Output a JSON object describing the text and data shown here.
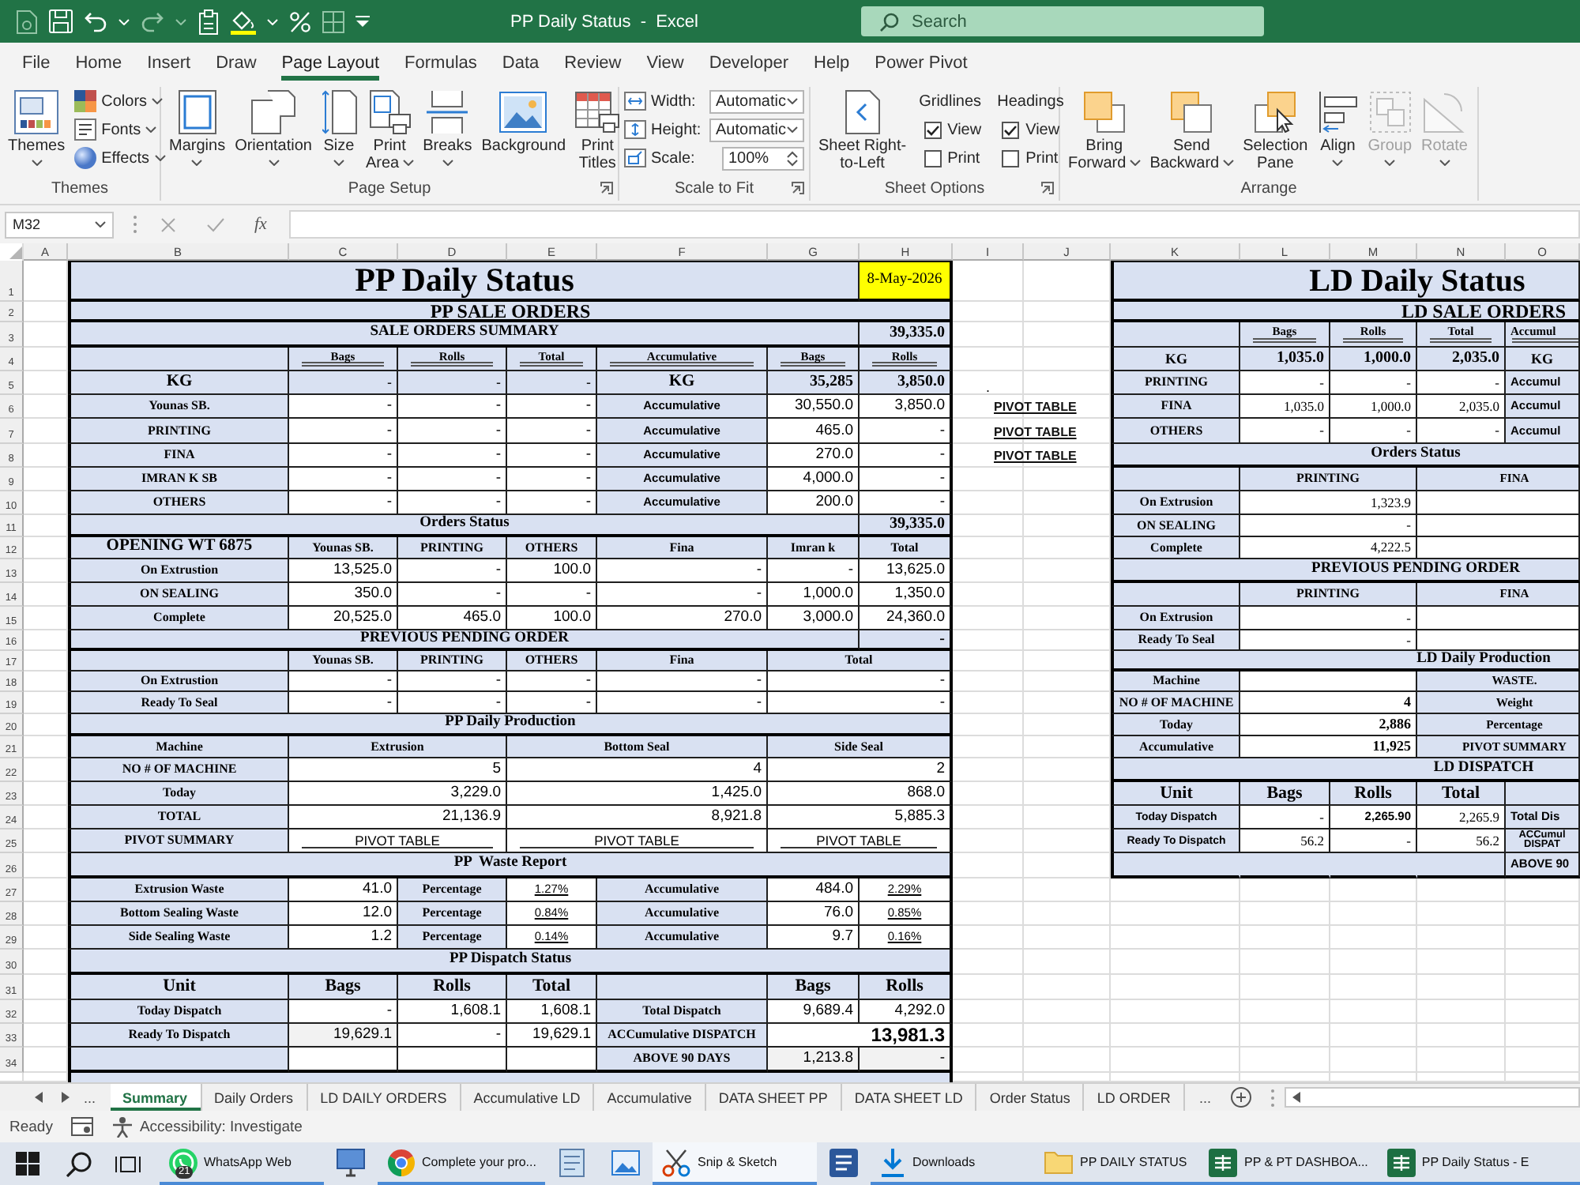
{
  "title_bar": {
    "title": "PP Daily Status  -  Excel",
    "search": {
      "placeholder": "Search"
    }
  },
  "ribbon": {
    "tabs": [
      {
        "label": "File",
        "selected": false
      },
      {
        "label": "Home",
        "selected": false
      },
      {
        "label": "Insert",
        "selected": false
      },
      {
        "label": "Draw",
        "selected": false
      },
      {
        "label": "Page Layout",
        "selected": true
      },
      {
        "label": "Formulas",
        "selected": false
      },
      {
        "label": "Data",
        "selected": false
      },
      {
        "label": "Review",
        "selected": false
      },
      {
        "label": "View",
        "selected": false
      },
      {
        "label": "Developer",
        "selected": false
      },
      {
        "label": "Help",
        "selected": false
      },
      {
        "label": "Power Pivot",
        "selected": false
      }
    ],
    "groups": [
      {
        "label": "Themes",
        "launcher": false,
        "items": [
          {
            "kind": "large",
            "label": "Themes",
            "dropdown": true
          },
          {
            "kind": "small",
            "label": "Colors",
            "dropdown": true
          },
          {
            "kind": "small",
            "label": "Fonts",
            "dropdown": true
          },
          {
            "kind": "small",
            "label": "Effects",
            "dropdown": true
          }
        ]
      },
      {
        "label": "Page Setup",
        "launcher": true,
        "items": [
          {
            "kind": "large",
            "label": "Margins",
            "dropdown": true
          },
          {
            "kind": "large",
            "label": "Orientation",
            "dropdown": true
          },
          {
            "kind": "large",
            "label": "Size",
            "dropdown": true
          },
          {
            "kind": "large",
            "label": "Print\nArea",
            "dropdown": true
          },
          {
            "kind": "large",
            "label": "Breaks",
            "dropdown": true
          },
          {
            "kind": "large",
            "label": "Background",
            "dropdown": false
          },
          {
            "kind": "large",
            "label": "Print\nTitles",
            "dropdown": false
          }
        ]
      },
      {
        "label": "Scale to Fit",
        "launcher": true,
        "items": [
          {
            "kind": "select",
            "label": "Width:",
            "value": "Automatic"
          },
          {
            "kind": "select",
            "label": "Height:",
            "value": "Automatic"
          },
          {
            "kind": "spin",
            "label": "Scale:",
            "value": "100%"
          }
        ]
      },
      {
        "label": "Sheet Options",
        "launcher": true,
        "items": [
          {
            "kind": "large",
            "label": "Sheet Right-\nto-Left",
            "dropdown": false
          },
          {
            "kind": "options",
            "label": "Gridlines",
            "options": [
              {
                "label": "View",
                "checked": true
              },
              {
                "label": "Print",
                "checked": false
              }
            ]
          },
          {
            "kind": "options",
            "label": "Headings",
            "options": [
              {
                "label": "View",
                "checked": true
              },
              {
                "label": "Print",
                "checked": false
              }
            ]
          }
        ]
      },
      {
        "label": "Arrange",
        "launcher": false,
        "items": [
          {
            "kind": "large",
            "label": "Bring\nForward",
            "dropdown": true,
            "disabled": false
          },
          {
            "kind": "large",
            "label": "Send\nBackward",
            "dropdown": true,
            "disabled": false
          },
          {
            "kind": "large",
            "label": "Selection\nPane",
            "dropdown": false,
            "disabled": false
          },
          {
            "kind": "large",
            "label": "Align",
            "dropdown": true,
            "disabled": false
          },
          {
            "kind": "large",
            "label": "Group",
            "dropdown": true,
            "disabled": true
          },
          {
            "kind": "large",
            "label": "Rotate",
            "dropdown": true,
            "disabled": true
          }
        ]
      }
    ]
  },
  "formula_bar": {
    "name_box": "M32",
    "function_label": "fx"
  },
  "sheet": {
    "columns": [
      "A",
      "B",
      "C",
      "D",
      "E",
      "F",
      "G",
      "H",
      "I",
      "J",
      "K",
      "L",
      "M",
      "N",
      "O"
    ],
    "row_numbers": [
      "1",
      "2",
      "3",
      "4",
      "5",
      "6",
      "7",
      "8",
      "9",
      "10",
      "11",
      "12",
      "13",
      "14",
      "15",
      "16",
      "17",
      "18",
      "19",
      "20",
      "21",
      "22",
      "23",
      "24",
      "25",
      "26",
      "27",
      "28",
      "29",
      "30",
      "31",
      "32",
      "33",
      "34"
    ]
  },
  "pp_daily_status": {
    "rows": [
      [
        "PP Daily Status",
        "8-May-2026"
      ],
      [
        "PP SALE ORDERS"
      ],
      [
        "SALE ORDERS SUMMARY",
        "39,335.0"
      ],
      [
        "",
        "Bags",
        "Rolls",
        "Total",
        "Accumulative",
        "Bags",
        "Rolls"
      ],
      [
        "KG",
        "-",
        "-",
        "-",
        "KG",
        "35,285",
        "3,850.0"
      ],
      [
        "Younas SB.",
        "-",
        "-",
        "-",
        "Accumulative",
        "30,550.0",
        "3,850.0"
      ],
      [
        "PRINTING",
        "-",
        "-",
        "-",
        "Accumulative",
        "465.0",
        "-"
      ],
      [
        "FINA",
        "-",
        "-",
        "-",
        "Accumulative",
        "270.0",
        "-"
      ],
      [
        "IMRAN K SB",
        "-",
        "-",
        "-",
        "Accumulative",
        "4,000.0",
        "-"
      ],
      [
        "OTHERS",
        "-",
        "-",
        "-",
        "Accumulative",
        "200.0",
        "-"
      ],
      [
        "Orders Status",
        "39,335.0"
      ],
      [
        "OPENING WT 6875",
        "Younas SB.",
        "PRINTING",
        "OTHERS",
        "Fina",
        "Imran k",
        "Total"
      ],
      [
        "On Extrustion",
        "13,525.0",
        "-",
        "100.0",
        "-",
        "-",
        "13,625.0"
      ],
      [
        "ON SEALING",
        "350.0",
        "-",
        "-",
        "-",
        "1,000.0",
        "1,350.0"
      ],
      [
        "Complete",
        "20,525.0",
        "465.0",
        "100.0",
        "270.0",
        "3,000.0",
        "24,360.0"
      ],
      [
        "PREVIOUS PENDING ORDER",
        "-"
      ],
      [
        "",
        "Younas SB.",
        "PRINTING",
        "OTHERS",
        "Fina",
        "Total"
      ],
      [
        "On Extrustion",
        "-",
        "-",
        "-",
        "-",
        "-"
      ],
      [
        "Ready To Seal",
        "-",
        "-",
        "-",
        "-",
        "-"
      ],
      [
        "PP Daily Production"
      ],
      [
        "Machine",
        "Extrusion",
        "Bottom Seal",
        "Side Seal"
      ],
      [
        "NO # OF MACHINE",
        "5",
        "4",
        "2"
      ],
      [
        "Today",
        "3,229.0",
        "1,425.0",
        "868.0"
      ],
      [
        "TOTAL",
        "21,136.9",
        "8,921.8",
        "5,885.3"
      ],
      [
        "PIVOT SUMMARY",
        "PIVOT TABLE",
        "PIVOT TABLE",
        "PIVOT TABLE"
      ],
      [
        "PP  Waste Report"
      ],
      [
        "Extrusion Waste",
        "41.0",
        "Percentage",
        "1.27%",
        "Accumulative",
        "484.0",
        "2.29%"
      ],
      [
        "Bottom Sealing Waste",
        "12.0",
        "Percentage",
        "0.84%",
        "Accumulative",
        "76.0",
        "0.85%"
      ],
      [
        "Side Sealing Waste",
        "1.2",
        "Percentage",
        "0.14%",
        "Accumulative",
        "9.7",
        "0.16%"
      ],
      [
        "PP Dispatch Status"
      ],
      [
        "Unit",
        "Bags",
        "Rolls",
        "Total",
        "",
        "Bags",
        "Rolls"
      ],
      [
        "Today Dispatch",
        "-",
        "1,608.1",
        "1,608.1",
        "Total Dispatch",
        "9,689.4",
        "4,292.0"
      ],
      [
        "Ready To Dispatch",
        "19,629.1",
        "-",
        "19,629.1",
        "ACCumulative DISPATCH",
        "13,981.3"
      ],
      [
        "",
        "",
        "",
        "",
        "ABOVE 90 DAYS",
        "1,213.8",
        "-"
      ]
    ]
  },
  "side_column": {
    "mark": ".",
    "links": [
      "PIVOT TABLE",
      "PIVOT TABLE",
      "PIVOT TABLE"
    ]
  },
  "ld_daily_status": {
    "rows": [
      [
        "LD Daily Status"
      ],
      [
        "LD SALE ORDERS"
      ],
      [
        "",
        "Bags",
        "Rolls",
        "Total",
        "Accumul"
      ],
      [
        "KG",
        "1,035.0",
        "1,000.0",
        "2,035.0",
        "KG"
      ],
      [
        "PRINTING",
        "-",
        "-",
        "-",
        "Accumul"
      ],
      [
        "FINA",
        "1,035.0",
        "1,000.0",
        "2,035.0",
        "Accumul"
      ],
      [
        "OTHERS",
        "-",
        "-",
        "-",
        "Accumul"
      ],
      [
        "Orders Status"
      ],
      [
        "",
        "PRINTING",
        "FINA"
      ],
      [
        "On Extrusion",
        "1,323.9"
      ],
      [
        "ON SEALING",
        "-"
      ],
      [
        "Complete",
        "4,222.5"
      ],
      [
        "PREVIOUS PENDING ORDER"
      ],
      [
        "",
        "PRINTING",
        "FINA"
      ],
      [
        "On Extrusion",
        "-"
      ],
      [
        "Ready To Seal",
        "-"
      ],
      [
        "LD Daily Production"
      ],
      [
        "Machine",
        "",
        "WASTE."
      ],
      [
        "NO # OF MACHINE",
        "4",
        "Weight"
      ],
      [
        "Today",
        "2,886",
        "Percentage"
      ],
      [
        "Accumulative",
        "11,925",
        "PIVOT SUMMARY"
      ],
      [
        "LD DISPATCH"
      ],
      [
        "Unit",
        "Bags",
        "Rolls",
        "Total"
      ],
      [
        "Today Dispatch",
        "-",
        "2,265.90",
        "2,265.9",
        "Total Dis"
      ],
      [
        "Ready To Dispatch",
        "56.2",
        "-",
        "56.2",
        "ACCumul\nDISPAT"
      ],
      [
        "",
        "",
        "",
        "",
        "ABOVE 90"
      ]
    ]
  },
  "sheet_tabs": {
    "leading_more": "...",
    "tabs": [
      {
        "label": "Summary",
        "selected": true
      },
      {
        "label": "Daily Orders",
        "selected": false
      },
      {
        "label": "LD DAILY ORDERS",
        "selected": false
      },
      {
        "label": "Accumulative LD",
        "selected": false
      },
      {
        "label": "Accumulative",
        "selected": false
      },
      {
        "label": "DATA SHEET PP",
        "selected": false
      },
      {
        "label": "DATA SHEET LD",
        "selected": false
      },
      {
        "label": "Order Status",
        "selected": false
      },
      {
        "label": "LD ORDER",
        "selected": false
      }
    ],
    "trailing_more": "..."
  },
  "status_bar": {
    "mode": "Ready",
    "accessibility": "Accessibility: Investigate"
  },
  "taskbar": {
    "apps": [
      {
        "label": "WhatsApp Web",
        "badge": "21",
        "running": true,
        "selected": false
      },
      {
        "running": false,
        "selected": false
      },
      {
        "label": "Complete your pro...",
        "running": true,
        "selected": false
      },
      {
        "running": false,
        "selected": false
      },
      {
        "running": false,
        "selected": false
      },
      {
        "label": "Snip & Sketch",
        "running": true,
        "selected": true
      },
      {
        "running": false,
        "selected": false
      },
      {
        "label": "Downloads",
        "running": true,
        "selected": false
      },
      {
        "label": "PP DAILY STATUS",
        "running": true,
        "selected": false
      },
      {
        "label": "PP & PT DASHBOA...",
        "running": true,
        "selected": false
      },
      {
        "label": "PP Daily Status - E",
        "running": true,
        "selected": false
      }
    ]
  }
}
